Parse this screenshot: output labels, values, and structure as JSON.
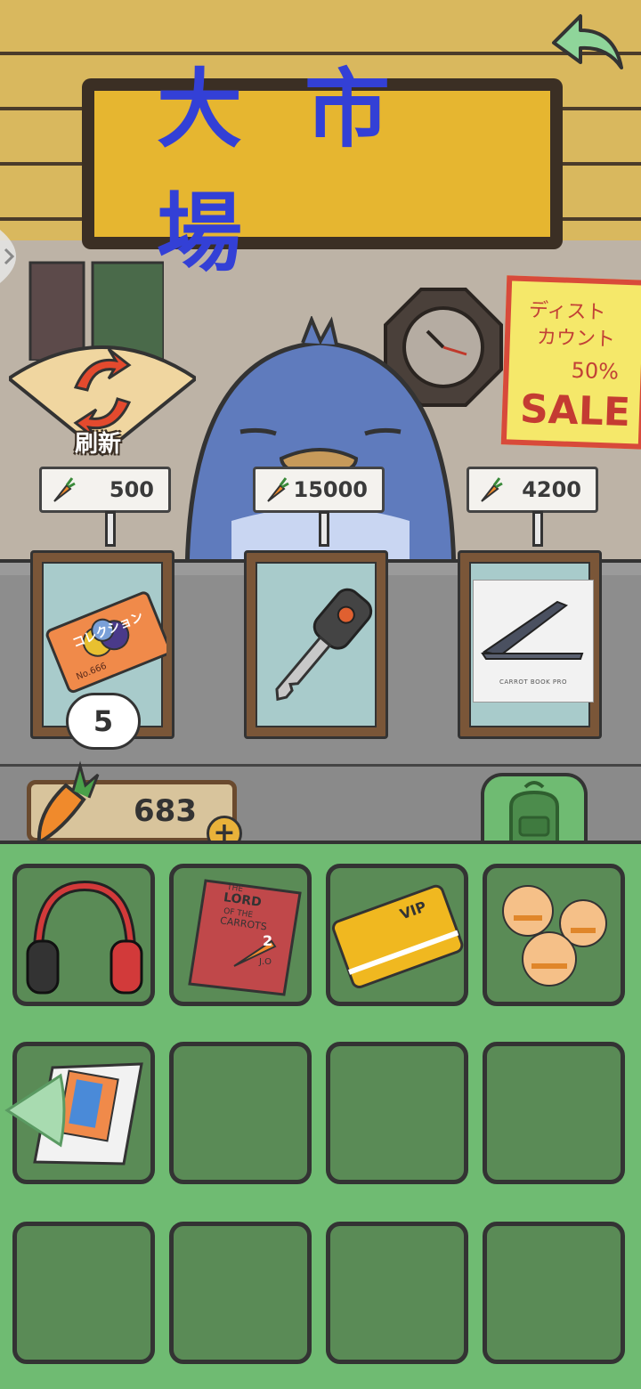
{
  "sign": {
    "title": "大市場"
  },
  "refresh": {
    "label": "刷新"
  },
  "poster": {
    "line1": "ディスト",
    "line2": "カウント",
    "percent": "50%",
    "sale": "SALE"
  },
  "shop": {
    "items": [
      {
        "price": "500",
        "item": "coupon-ticket",
        "quantity": "5",
        "ticket_text": "コレクション",
        "ticket_no": "No.666"
      },
      {
        "price": "15000",
        "item": "car-key"
      },
      {
        "price": "4200",
        "item": "laptop",
        "caption": "CARROT BOOK PRO"
      }
    ]
  },
  "wallet": {
    "carrots": "683",
    "plus": "+"
  },
  "inventory": {
    "slots": [
      {
        "item": "headphones"
      },
      {
        "item": "book",
        "title_line1": "THE",
        "title_line2": "LORD",
        "title_line3": "OF THE",
        "title_line4": "CARROTS",
        "volume": "2",
        "author": "J.O"
      },
      {
        "item": "vip-card",
        "text": "VIP"
      },
      {
        "item": "animal-cookies"
      },
      {
        "item": "phone-box"
      },
      {
        "item": ""
      },
      {
        "item": ""
      },
      {
        "item": ""
      },
      {
        "item": ""
      },
      {
        "item": ""
      },
      {
        "item": ""
      },
      {
        "item": ""
      }
    ]
  },
  "colors": {
    "sign_bg": "#e6b630",
    "sign_text": "#3340d6",
    "inventory_bg": "#6fbb72",
    "slot_bg": "#5a8b56",
    "penguin": "#5f7bbd"
  }
}
